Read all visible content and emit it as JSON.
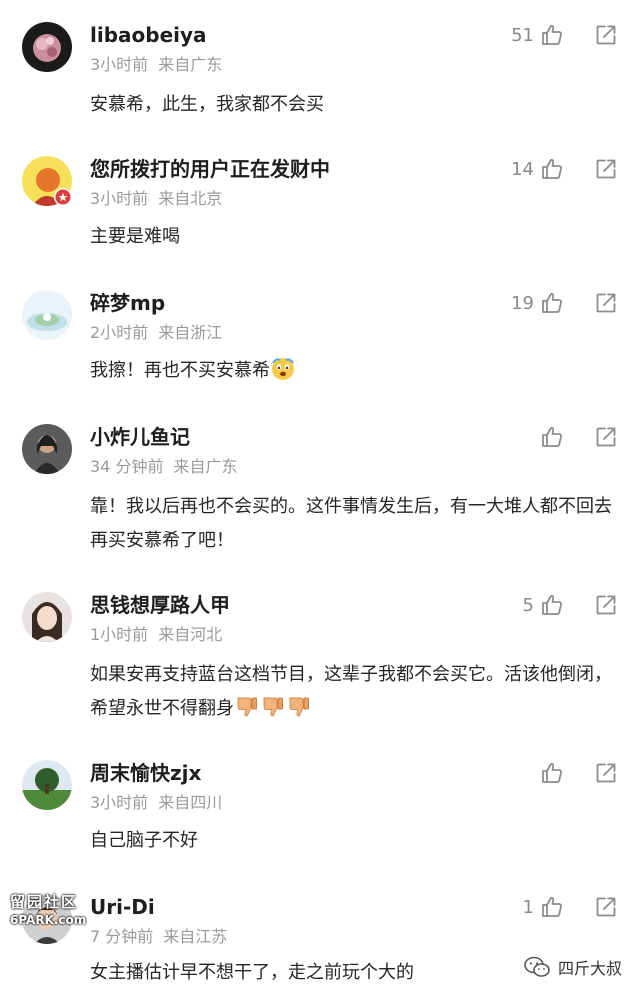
{
  "comments": [
    {
      "username": "libaobeiya",
      "time": "3小时前",
      "location": "来自广东",
      "likes": "51",
      "text": "安慕希，此生，我家都不会买"
    },
    {
      "username": "您所拨打的用户正在发财中",
      "time": "3小时前",
      "location": "来自北京",
      "likes": "14",
      "text": "主要是难喝"
    },
    {
      "username": "碎梦mp",
      "time": "2小时前",
      "location": "来自浙江",
      "likes": "19",
      "text": "我擦！再也不买安慕希"
    },
    {
      "username": "小炸儿鱼记",
      "time": "34 分钟前",
      "location": "来自广东",
      "likes": "",
      "text": "靠！我以后再也不会买的。这件事情发生后，有一大堆人都不回去再买安慕希了吧！"
    },
    {
      "username": "思钱想厚路人甲",
      "time": "1小时前",
      "location": "来自河北",
      "likes": "5",
      "text": "如果安再支持蓝台这档节目，这辈子我都不会买它。活该他倒闭，希望永世不得翻身"
    },
    {
      "username": "周末愉快zjx",
      "time": "3小时前",
      "location": "来自四川",
      "likes": "",
      "text": "自己脑子不好"
    },
    {
      "username": "Uri-Di",
      "time": "7 分钟前",
      "location": "来自江苏",
      "likes": "1",
      "text": "女主播估计早不想干了，走之前玩个大的"
    }
  ],
  "watermark_left": {
    "line1": "留园社区",
    "line2": "6PARK.com"
  },
  "watermark_right": {
    "text": "四斤大叔"
  },
  "icons": {
    "like": "thumbs-up-outline-icon",
    "share": "share-box-icon"
  }
}
